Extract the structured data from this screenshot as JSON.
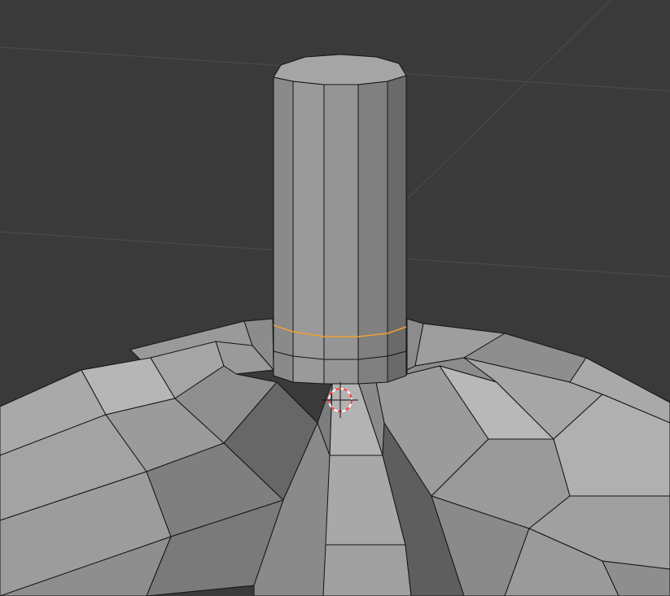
{
  "viewport": {
    "mode": "Edit Mode",
    "background_color": "#3a3a3a",
    "grid_color": "#4a4a4a",
    "selected_edge_color": "#f0a030",
    "cursor_colors": [
      "#ff3c3c",
      "#ffffff"
    ],
    "mesh_shades": [
      "#b9b9b9",
      "#a7a7a7",
      "#999999",
      "#8a8a8a",
      "#7b7b7b",
      "#6c6c6c",
      "#5e5e5e"
    ]
  },
  "objects": [
    {
      "name": "cylinder",
      "selected_loop": "cylinder-base-edge-loop"
    },
    {
      "name": "sphere"
    }
  ],
  "cursor": {
    "icon": "3d-cursor-icon"
  }
}
